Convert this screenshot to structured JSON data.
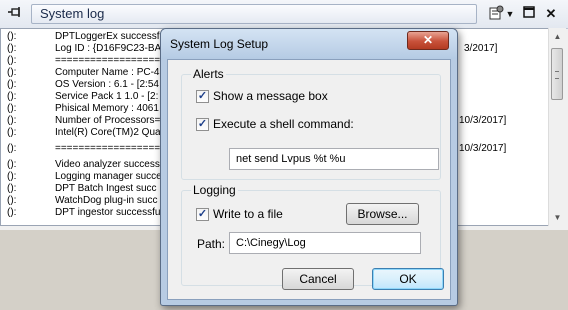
{
  "toolbar": {
    "pin_icon": "pin-icon",
    "title": "System log",
    "properties_icon": "properties-icon",
    "dropdown_icon": "chevron-down-icon",
    "restore_icon": "restore-icon",
    "close_icon": "close-icon"
  },
  "log": {
    "rows": [
      {
        "prefix": "():",
        "text": "DPTLoggerEx successf",
        "tail": ""
      },
      {
        "prefix": "():",
        "text": "Log ID : {D16F9C23-BA",
        "tail": "3/2017]"
      },
      {
        "prefix": "():",
        "text": "==================",
        "tail": ""
      },
      {
        "prefix": "():",
        "text": "Computer Name : PC-4",
        "tail": ""
      },
      {
        "prefix": "():",
        "text": "OS Version : 6.1 - [2:54",
        "tail": ""
      },
      {
        "prefix": "():",
        "text": "Service Pack 1 1.0 - [2:",
        "tail": ""
      },
      {
        "prefix": "():",
        "text": "Phisical Memory : 4061",
        "tail": ""
      },
      {
        "prefix": "():",
        "text": "Number of Processors=",
        "tail": "10/3/2017]"
      },
      {
        "prefix": "():",
        "text": "Intel(R) Core(TM)2 Qua",
        "tail": ""
      },
      {
        "prefix": "():",
        "text": "==================",
        "tail": "10/3/2017]"
      },
      {
        "prefix": "():",
        "text": "Video analyzer success",
        "tail": ""
      },
      {
        "prefix": "():",
        "text": "Logging manager succes",
        "tail": ""
      },
      {
        "prefix": "():",
        "text": "DPT Batch Ingest succ",
        "tail": ""
      },
      {
        "prefix": "():",
        "text": "WatchDog plug-in succ",
        "tail": ""
      },
      {
        "prefix": "():",
        "text": "DPT ingestor successfu",
        "tail": ""
      }
    ]
  },
  "dialog": {
    "title": "System Log Setup",
    "close_label": "✕",
    "alerts": {
      "group_label": "Alerts",
      "show_message_box_label": "Show a message box",
      "show_message_box_checked": true,
      "execute_shell_label": "Execute a shell command:",
      "execute_shell_checked": true,
      "command_value": "net send Lvpus %t %u"
    },
    "logging": {
      "group_label": "Logging",
      "write_to_file_label": "Write to a file",
      "write_to_file_checked": true,
      "browse_label": "Browse...",
      "path_label": "Path:",
      "path_value": "C:\\Cinegy\\Log"
    },
    "cancel_label": "Cancel",
    "ok_label": "OK"
  }
}
